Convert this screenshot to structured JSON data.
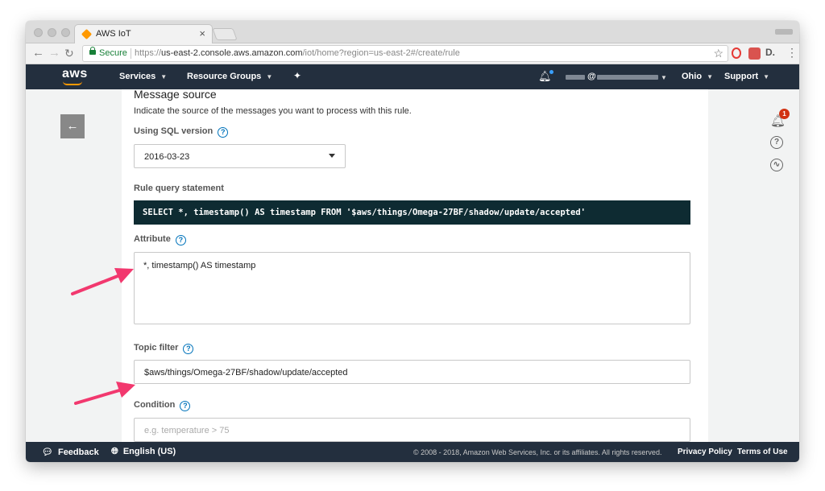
{
  "browser": {
    "tab_title": "AWS IoT",
    "tab_close": "×",
    "secure_label": "Secure",
    "url_scheme": "https://",
    "url_host": "us-east-2.console.aws.amazon.com",
    "url_path": "/iot/home?region=us-east-2#/create/rule"
  },
  "nav": {
    "logo": "aws",
    "services": "Services",
    "resource_groups": "Resource Groups",
    "account_at": "@",
    "region": "Ohio",
    "support": "Support"
  },
  "form": {
    "section_title": "Message source",
    "section_description": "Indicate the source of the messages you want to process with this rule.",
    "sql_version_label": "Using SQL version",
    "sql_version_value": "2016-03-23",
    "rule_query_label": "Rule query statement",
    "rule_query_value": "SELECT *, timestamp() AS timestamp FROM '$aws/things/Omega-27BF/shadow/update/accepted'",
    "attribute_label": "Attribute",
    "attribute_value": "*, timestamp() AS timestamp",
    "topic_filter_label": "Topic filter",
    "topic_filter_value": "$aws/things/Omega-27BF/shadow/update/accepted",
    "condition_label": "Condition",
    "condition_placeholder": "e.g. temperature > 75"
  },
  "sidebar_right": {
    "notification_count": "1"
  },
  "footer": {
    "feedback": "Feedback",
    "language": "English (US)",
    "copyright": "© 2008 - 2018, Amazon Web Services, Inc. or its affiliates. All rights reserved.",
    "privacy": "Privacy Policy",
    "terms": "Terms of Use"
  },
  "colors": {
    "aws_nav": "#232f3e",
    "aws_orange": "#ff9900",
    "code_bg": "#0e2b32",
    "link_blue": "#0073bb",
    "annotation_arrow": "#f2386e"
  },
  "icons": [
    "back-arrow-icon",
    "help-icon",
    "bell-icon",
    "pin-icon",
    "question-icon",
    "health-icon",
    "globe-icon",
    "chat-icon",
    "lock-icon",
    "star-icon"
  ]
}
